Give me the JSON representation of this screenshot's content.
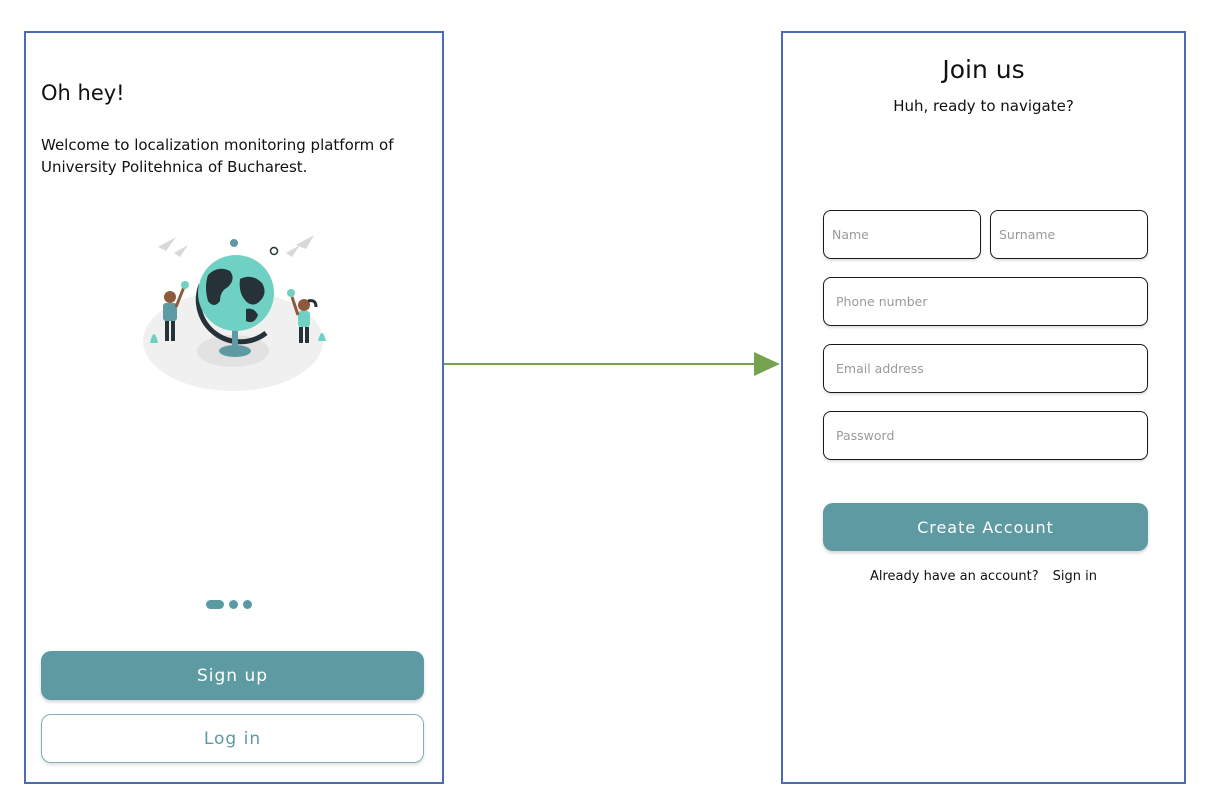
{
  "welcome": {
    "title": "Oh hey!",
    "text": "Welcome to localization monitoring platform of University Politehnica of Bucharest.",
    "signup_label": "Sign up",
    "login_label": "Log in",
    "carousel_pages": 3,
    "carousel_active_index": 0
  },
  "signup": {
    "title": "Join us",
    "subtitle": "Huh, ready to navigate?",
    "fields": {
      "name_placeholder": "Name",
      "surname_placeholder": "Surname",
      "phone_placeholder": "Phone number",
      "email_placeholder": "Email address",
      "password_placeholder": "Password"
    },
    "create_label": "Create Account",
    "already_text": "Already have an account?",
    "signin_label": "Sign in"
  },
  "colors": {
    "accent": "#5e9aa2",
    "frame": "#4a6bb5",
    "arrow": "#76a34f"
  },
  "icons": {
    "illustration": "globe-illustration-icon",
    "arrow": "arrow-right-icon"
  }
}
